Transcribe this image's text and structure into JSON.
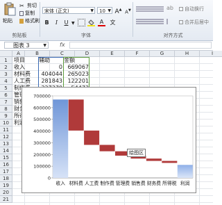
{
  "ribbon": {
    "clipboard": {
      "paste": "粘贴",
      "cut": "剪切",
      "copy": "复制",
      "format_painter": "格式刷",
      "group_label": "剪贴板"
    },
    "font": {
      "family": "宋体 (正文)",
      "size": "10",
      "grow": "A",
      "shrink": "A",
      "bold": "B",
      "italic": "I",
      "underline": "U",
      "font_color_letter": "A",
      "wen": "文",
      "group_label": "字体"
    },
    "alignment": {
      "wrap": "自动换行",
      "merge": "合并后居中",
      "group_label": "对齐方式"
    }
  },
  "formula_bar": {
    "name_box": "图表 3",
    "fx": "fx"
  },
  "sheet": {
    "columns": [
      "A",
      "B",
      "C",
      "D",
      "E",
      "F",
      "G",
      "H",
      "I"
    ],
    "rows": [
      "1",
      "2",
      "3",
      "4",
      "5",
      "6",
      "7",
      "8",
      "9",
      "10",
      "11",
      "12",
      "13",
      "14",
      "15",
      "16",
      "17",
      "18",
      "19",
      "20",
      "21"
    ],
    "headers": [
      "项目",
      "辅助",
      "金额"
    ],
    "data": [
      [
        "收入",
        "0",
        "669067"
      ],
      [
        "材料费",
        "404044",
        "265023"
      ],
      [
        "人工费",
        "281843",
        "122201"
      ],
      [
        "制作费",
        "227370",
        "54473"
      ]
    ],
    "hidden_labels": [
      "管理",
      "销售",
      "财务",
      "所得",
      "利润"
    ]
  },
  "chart_data": {
    "type": "bar",
    "subtype": "waterfall (stacked with invisible helper)",
    "categories": [
      "收入",
      "材料费",
      "人工费",
      "制作费",
      "管理费",
      "销售费",
      "财务费",
      "所得税",
      "利润"
    ],
    "series": [
      {
        "name": "辅助",
        "values": [
          0,
          404044,
          281843,
          227370,
          190000,
          165000,
          145000,
          128000,
          0
        ]
      },
      {
        "name": "金额",
        "values": [
          669067,
          265023,
          122201,
          54473,
          37370,
          25000,
          20000,
          17000,
          111000
        ]
      }
    ],
    "ylim": [
      0,
      700000
    ],
    "yticks": [
      "0",
      "100000",
      "200000",
      "300000",
      "400000",
      "500000",
      "600000",
      "700000"
    ],
    "colors": {
      "first": "#7a9fdc",
      "middle": "#b03a3a",
      "last": "#9cb7e8"
    },
    "tooltip": "绘图区"
  },
  "colors": {
    "ribbon_bg": "#e4eaf2",
    "header_bg": "#e9edf2",
    "selection": "#3a6ab4"
  }
}
